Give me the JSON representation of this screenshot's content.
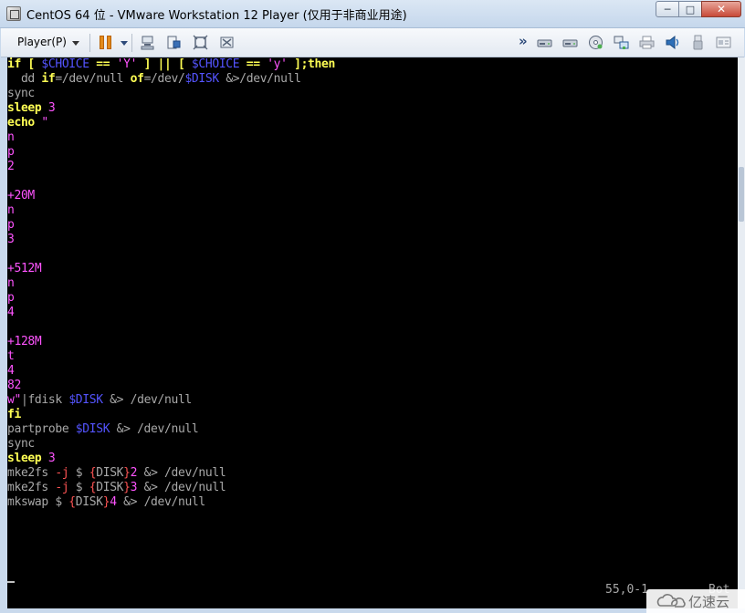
{
  "window": {
    "title": "CentOS 64 位 - VMware Workstation 12 Player (仅用于非商业用途)",
    "min_glyph": "─",
    "max_glyph": "□",
    "close_glyph": "✕"
  },
  "toolbar": {
    "player_menu_label": "Player(P)",
    "more_glyph": "»",
    "icons": [
      "pause-icon",
      "send-ctrl-alt-del-icon",
      "unity-icon",
      "fit-guest-icon",
      "fullscreen-icon",
      "more-devices-icon",
      "hard-disk-1-icon",
      "hard-disk-2-icon",
      "cd-dvd-icon",
      "network-adapter-icon",
      "printer-icon",
      "sound-card-icon",
      "usb-icon",
      "message-log-icon"
    ]
  },
  "console": {
    "lines": [
      [
        {
          "t": "if [ ",
          "c": "c-yellow bold"
        },
        {
          "t": "$CHOICE",
          "c": "c-blue"
        },
        {
          "t": " == ",
          "c": "c-yellow bold"
        },
        {
          "t": "'Y'",
          "c": "c-magenta"
        },
        {
          "t": " ] || [ ",
          "c": "c-yellow bold"
        },
        {
          "t": "$CHOICE",
          "c": "c-blue"
        },
        {
          "t": " == ",
          "c": "c-yellow bold"
        },
        {
          "t": "'y'",
          "c": "c-magenta"
        },
        {
          "t": " ];then",
          "c": "c-yellow bold"
        }
      ],
      [
        {
          "t": "  dd ",
          "c": "c-white"
        },
        {
          "t": "if",
          "c": "c-yellow bold"
        },
        {
          "t": "=/dev/null ",
          "c": "c-white"
        },
        {
          "t": "of",
          "c": "c-yellow bold"
        },
        {
          "t": "=/dev/",
          "c": "c-white"
        },
        {
          "t": "$DISK",
          "c": "c-blue"
        },
        {
          "t": " &>/dev/null",
          "c": "c-white"
        }
      ],
      [
        {
          "t": "sync",
          "c": "c-white"
        }
      ],
      [
        {
          "t": "sleep ",
          "c": "c-yellow bold"
        },
        {
          "t": "3",
          "c": "c-magenta"
        }
      ],
      [
        {
          "t": "echo ",
          "c": "c-yellow bold"
        },
        {
          "t": "\"",
          "c": "c-magenta"
        }
      ],
      [
        {
          "t": "n",
          "c": "c-magenta"
        }
      ],
      [
        {
          "t": "p",
          "c": "c-magenta"
        }
      ],
      [
        {
          "t": "2",
          "c": "c-magenta"
        }
      ],
      [
        {
          "t": "",
          "c": "c-magenta"
        }
      ],
      [
        {
          "t": "+20M",
          "c": "c-magenta"
        }
      ],
      [
        {
          "t": "n",
          "c": "c-magenta"
        }
      ],
      [
        {
          "t": "p",
          "c": "c-magenta"
        }
      ],
      [
        {
          "t": "3",
          "c": "c-magenta"
        }
      ],
      [
        {
          "t": "",
          "c": "c-magenta"
        }
      ],
      [
        {
          "t": "+512M",
          "c": "c-magenta"
        }
      ],
      [
        {
          "t": "n",
          "c": "c-magenta"
        }
      ],
      [
        {
          "t": "p",
          "c": "c-magenta"
        }
      ],
      [
        {
          "t": "4",
          "c": "c-magenta"
        }
      ],
      [
        {
          "t": "",
          "c": "c-magenta"
        }
      ],
      [
        {
          "t": "+128M",
          "c": "c-magenta"
        }
      ],
      [
        {
          "t": "t",
          "c": "c-magenta"
        }
      ],
      [
        {
          "t": "4",
          "c": "c-magenta"
        }
      ],
      [
        {
          "t": "82",
          "c": "c-magenta"
        }
      ],
      [
        {
          "t": "w\"",
          "c": "c-magenta"
        },
        {
          "t": "|fdisk ",
          "c": "c-white"
        },
        {
          "t": "$DISK",
          "c": "c-blue"
        },
        {
          "t": " &> /dev/null",
          "c": "c-white"
        }
      ],
      [
        {
          "t": "fi",
          "c": "c-yellow bold"
        }
      ],
      [
        {
          "t": "partprobe ",
          "c": "c-white"
        },
        {
          "t": "$DISK",
          "c": "c-blue"
        },
        {
          "t": " &> /dev/null",
          "c": "c-white"
        }
      ],
      [
        {
          "t": "sync",
          "c": "c-white"
        }
      ],
      [
        {
          "t": "sleep ",
          "c": "c-yellow bold"
        },
        {
          "t": "3",
          "c": "c-magenta"
        }
      ],
      [
        {
          "t": "mke2fs ",
          "c": "c-white"
        },
        {
          "t": "-j",
          "c": "c-red"
        },
        {
          "t": " $ ",
          "c": "c-white"
        },
        {
          "t": "{",
          "c": "c-red"
        },
        {
          "t": "DISK",
          "c": "c-white"
        },
        {
          "t": "}",
          "c": "c-red"
        },
        {
          "t": "2",
          "c": "c-magenta"
        },
        {
          "t": " &> /dev/null",
          "c": "c-white"
        }
      ],
      [
        {
          "t": "mke2fs ",
          "c": "c-white"
        },
        {
          "t": "-j",
          "c": "c-red"
        },
        {
          "t": " $ ",
          "c": "c-white"
        },
        {
          "t": "{",
          "c": "c-red"
        },
        {
          "t": "DISK",
          "c": "c-white"
        },
        {
          "t": "}",
          "c": "c-red"
        },
        {
          "t": "3",
          "c": "c-magenta"
        },
        {
          "t": " &> /dev/null",
          "c": "c-white"
        }
      ],
      [
        {
          "t": "mkswap $ ",
          "c": "c-white"
        },
        {
          "t": "{",
          "c": "c-red"
        },
        {
          "t": "DISK",
          "c": "c-white"
        },
        {
          "t": "}",
          "c": "c-red"
        },
        {
          "t": "4",
          "c": "c-magenta"
        },
        {
          "t": " &> /dev/null",
          "c": "c-white"
        }
      ]
    ],
    "status_position": "55,0-1",
    "status_scroll": "Bot"
  },
  "watermark": {
    "text": "亿速云"
  },
  "colors": {
    "console_bg": "#000000",
    "keyword": "#ffff54",
    "string": "#ff54ff",
    "variable": "#5454ff",
    "option": "#ff5454",
    "plain": "#a8a8a8"
  }
}
